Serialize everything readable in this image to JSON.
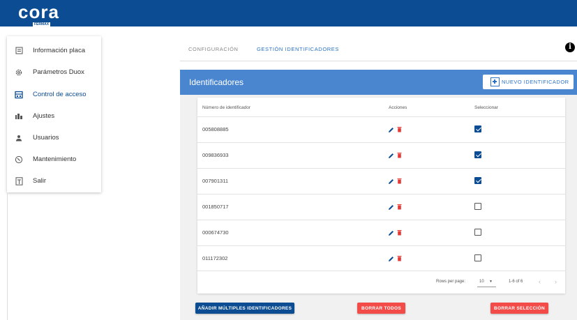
{
  "brand": {
    "logo_text": "cora",
    "logo_sub": "FERMAX"
  },
  "sidebar": {
    "items": [
      {
        "label": "Información placa",
        "icon": "info-card-icon"
      },
      {
        "label": "Parámetros Duox",
        "icon": "gear-icon"
      },
      {
        "label": "Control de acceso",
        "icon": "access-control-icon",
        "active": true
      },
      {
        "label": "Ajustes",
        "icon": "settings-sliders-icon"
      },
      {
        "label": "Usuarios",
        "icon": "user-icon"
      },
      {
        "label": "Mantenimiento",
        "icon": "maintenance-icon"
      },
      {
        "label": "Salir",
        "icon": "exit-icon"
      }
    ]
  },
  "tabs": [
    {
      "label": "CONFIGURACIÓN"
    },
    {
      "label": "GESTIÓN IDENTIFICADORES",
      "active": true
    }
  ],
  "panel": {
    "title": "Identificadores",
    "new_button_label": "NUEVO IDENTIFICADOR"
  },
  "table": {
    "headers": [
      "Número de identificador",
      "Acciones",
      "Seleccionar"
    ],
    "rows": [
      {
        "id": "005808885",
        "selected": true
      },
      {
        "id": "009836933",
        "selected": true
      },
      {
        "id": "007901311",
        "selected": true
      },
      {
        "id": "001850717",
        "selected": false
      },
      {
        "id": "000674730",
        "selected": false
      },
      {
        "id": "011172302",
        "selected": false
      }
    ],
    "footer": {
      "rows_per_page_label": "Rows per page:",
      "rows_per_page_value": "10",
      "range": "1-6 of 6"
    }
  },
  "actions": {
    "add_multiple": "AÑADIR MÚLTIPLES IDENTIFICADORES",
    "delete_all": "BORRAR TODOS",
    "delete_selection": "BORRAR SELECCIÓN"
  },
  "colors": {
    "topbar": "#0b4c93",
    "panel_header": "#4a86d0",
    "danger": "#f24b48",
    "checkbox_on": "#0b4c93"
  }
}
